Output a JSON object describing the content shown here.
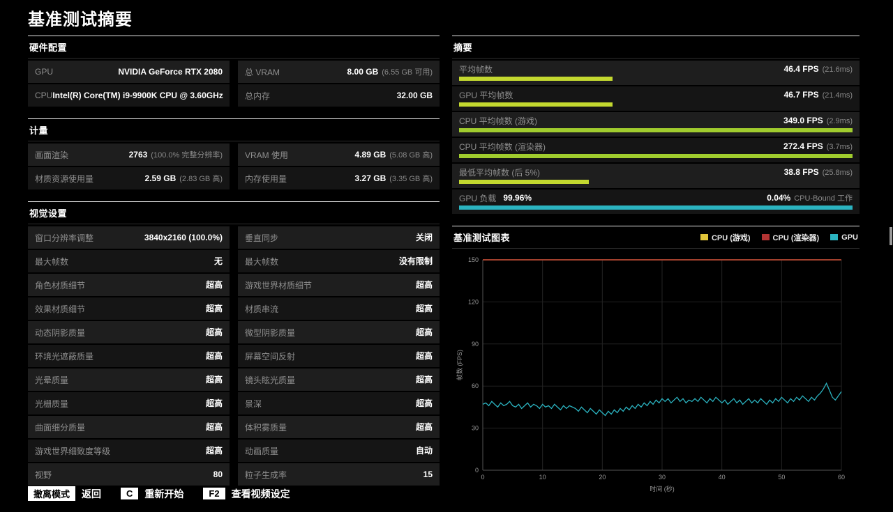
{
  "page_title": "基准测试摘要",
  "colors": {
    "panel_row_light": "#1e1e1e",
    "panel_row_dark": "#151515",
    "bar_lime": "#c3d82f",
    "bar_green": "#a0cc2e",
    "bar_teal": "#2bb3c0",
    "legend_yellow": "#e0c53a",
    "legend_red": "#b23433",
    "legend_teal": "#2bb3c0"
  },
  "panels": {
    "hardware": {
      "title": "硬件配置",
      "rows": [
        [
          {
            "label": "GPU",
            "value": "NVIDIA GeForce RTX 2080",
            "sub": ""
          },
          {
            "label": "总 VRAM",
            "value": "8.00 GB",
            "sub": "(6.55 GB 可用)"
          }
        ],
        [
          {
            "label": "CPU",
            "value": "Intel(R) Core(TM) i9-9900K CPU @ 3.60GHz",
            "sub": ""
          },
          {
            "label": "总内存",
            "value": "32.00 GB",
            "sub": ""
          }
        ]
      ]
    },
    "metrics": {
      "title": "计量",
      "rows": [
        [
          {
            "label": "画面渲染",
            "value": "2763",
            "sub": "(100.0% 完整分辨率)"
          },
          {
            "label": "VRAM 使用",
            "value": "4.89 GB",
            "sub": "(5.08 GB 高)"
          }
        ],
        [
          {
            "label": "材质资源使用量",
            "value": "2.59 GB",
            "sub": "(2.83 GB 高)"
          },
          {
            "label": "内存使用量",
            "value": "3.27 GB",
            "sub": "(3.35 GB 高)"
          }
        ]
      ]
    },
    "visual": {
      "title": "视觉设置",
      "rows": [
        [
          {
            "label": "窗口分辨率调整",
            "value": "3840x2160 (100.0%)",
            "sub": ""
          },
          {
            "label": "垂直同步",
            "value": "关闭",
            "sub": ""
          }
        ],
        [
          {
            "label": "最大帧数",
            "value": "无",
            "sub": ""
          },
          {
            "label": "最大帧数",
            "value": "没有限制",
            "sub": ""
          }
        ],
        [
          {
            "label": "角色材质细节",
            "value": "超高",
            "sub": ""
          },
          {
            "label": "游戏世界材质细节",
            "value": "超高",
            "sub": ""
          }
        ],
        [
          {
            "label": "效果材质细节",
            "value": "超高",
            "sub": ""
          },
          {
            "label": "材质串流",
            "value": "超高",
            "sub": ""
          }
        ],
        [
          {
            "label": "动态阴影质量",
            "value": "超高",
            "sub": ""
          },
          {
            "label": "微型阴影质量",
            "value": "超高",
            "sub": ""
          }
        ],
        [
          {
            "label": "环境光遮蔽质量",
            "value": "超高",
            "sub": ""
          },
          {
            "label": "屏幕空间反射",
            "value": "超高",
            "sub": ""
          }
        ],
        [
          {
            "label": "光晕质量",
            "value": "超高",
            "sub": ""
          },
          {
            "label": "镜头眩光质量",
            "value": "超高",
            "sub": ""
          }
        ],
        [
          {
            "label": "光栅质量",
            "value": "超高",
            "sub": ""
          },
          {
            "label": "景深",
            "value": "超高",
            "sub": ""
          }
        ],
        [
          {
            "label": "曲面细分质量",
            "value": "超高",
            "sub": ""
          },
          {
            "label": "体积雾质量",
            "value": "超高",
            "sub": ""
          }
        ],
        [
          {
            "label": "游戏世界细致度等级",
            "value": "超高",
            "sub": ""
          },
          {
            "label": "动画质量",
            "value": "自动",
            "sub": ""
          }
        ],
        [
          {
            "label": "视野",
            "value": "80",
            "sub": ""
          },
          {
            "label": "粒子生成率",
            "value": "15",
            "sub": ""
          }
        ]
      ]
    },
    "summary": {
      "title": "摘要",
      "rows": [
        {
          "label": "平均帧数",
          "value": "46.4 FPS",
          "sub": "(21.6ms)",
          "bar_pct": 39,
          "bar_color": "#c3d82f"
        },
        {
          "label": "GPU 平均帧数",
          "value": "46.7 FPS",
          "sub": "(21.4ms)",
          "bar_pct": 39,
          "bar_color": "#c3d82f"
        },
        {
          "label": "CPU 平均帧数 (游戏)",
          "value": "349.0 FPS",
          "sub": "(2.9ms)",
          "bar_pct": 100,
          "bar_color": "#a0cc2e"
        },
        {
          "label": "CPU 平均帧数 (渲染器)",
          "value": "272.4 FPS",
          "sub": "(3.7ms)",
          "bar_pct": 100,
          "bar_color": "#a0cc2e"
        },
        {
          "label": "最低平均帧数 (后 5%)",
          "value": "38.8 FPS",
          "sub": "(25.8ms)",
          "bar_pct": 33,
          "bar_color": "#c3d82f"
        },
        {
          "label": "GPU 负载",
          "label_value": "99.96%",
          "value": "0.04%",
          "sub": "CPU-Bound 工作",
          "bar_pct": 100,
          "bar_color": "#2bb3c0"
        }
      ]
    }
  },
  "chart_data": {
    "type": "line",
    "title": "基准测试图表",
    "xlabel": "时间 (秒)",
    "ylabel": "帧数 (FPS)",
    "x_range": [
      0,
      60
    ],
    "y_range": [
      0,
      150
    ],
    "x_ticks": [
      0,
      10,
      20,
      30,
      40,
      50,
      60
    ],
    "y_ticks": [
      0,
      30,
      60,
      90,
      120,
      150
    ],
    "grid": true,
    "legend_position": "top-right",
    "series": [
      {
        "name": "CPU (游戏)",
        "color": "#e0c53a",
        "type": "flat",
        "value": 150
      },
      {
        "name": "CPU (渲染器)",
        "color": "#b23433",
        "type": "flat",
        "value": 150
      },
      {
        "name": "GPU",
        "color": "#2bb3c0",
        "type": "points",
        "x_start": 0,
        "x_step": 0.5,
        "values": [
          47,
          48,
          46,
          49,
          47,
          45,
          48,
          46,
          47,
          49,
          46,
          45,
          47,
          44,
          46,
          48,
          45,
          47,
          46,
          44,
          47,
          45,
          46,
          44,
          47,
          45,
          43,
          46,
          44,
          46,
          45,
          44,
          42,
          45,
          43,
          41,
          44,
          42,
          40,
          43,
          41,
          39,
          42,
          40,
          43,
          41,
          44,
          42,
          45,
          43,
          46,
          44,
          47,
          45,
          48,
          46,
          49,
          47,
          50,
          48,
          51,
          49,
          51,
          48,
          50,
          52,
          49,
          51,
          48,
          50,
          49,
          51,
          49,
          52,
          50,
          48,
          51,
          49,
          52,
          50,
          48,
          50,
          47,
          49,
          51,
          48,
          50,
          47,
          49,
          51,
          48,
          50,
          48,
          51,
          49,
          47,
          50,
          48,
          51,
          49,
          52,
          50,
          48,
          51,
          49,
          52,
          50,
          53,
          51,
          49,
          52,
          50,
          53,
          55,
          58,
          62,
          57,
          52,
          50,
          53,
          56
        ]
      }
    ]
  },
  "footer": {
    "items": [
      {
        "key": "撤离模式",
        "action": "返回"
      },
      {
        "key": "C",
        "action": "重新开始"
      },
      {
        "key": "F2",
        "action": "查看视频设定"
      }
    ]
  }
}
